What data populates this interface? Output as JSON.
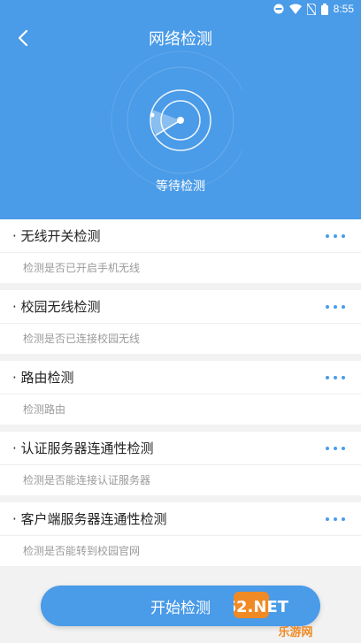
{
  "status": {
    "time": "8:55"
  },
  "header": {
    "title": "网络检测",
    "status_text": "等待检测"
  },
  "items": [
    {
      "title": "· 无线开关检测",
      "desc": "检测是否已开启手机无线"
    },
    {
      "title": "· 校园无线检测",
      "desc": "检测是否已连接校园无线"
    },
    {
      "title": "· 路由检测",
      "desc": "检测路由"
    },
    {
      "title": "· 认证服务器连通性检测",
      "desc": "检测是否能连接认证服务器"
    },
    {
      "title": "· 客户端服务器连通性检测",
      "desc": "检测是否能转到校园官网"
    }
  ],
  "start_button": "开始检测",
  "watermark": {
    "brand": "962.NET",
    "sub": "乐游网"
  },
  "colors": {
    "primary": "#4a9be8",
    "background": "#f2f2f2"
  }
}
